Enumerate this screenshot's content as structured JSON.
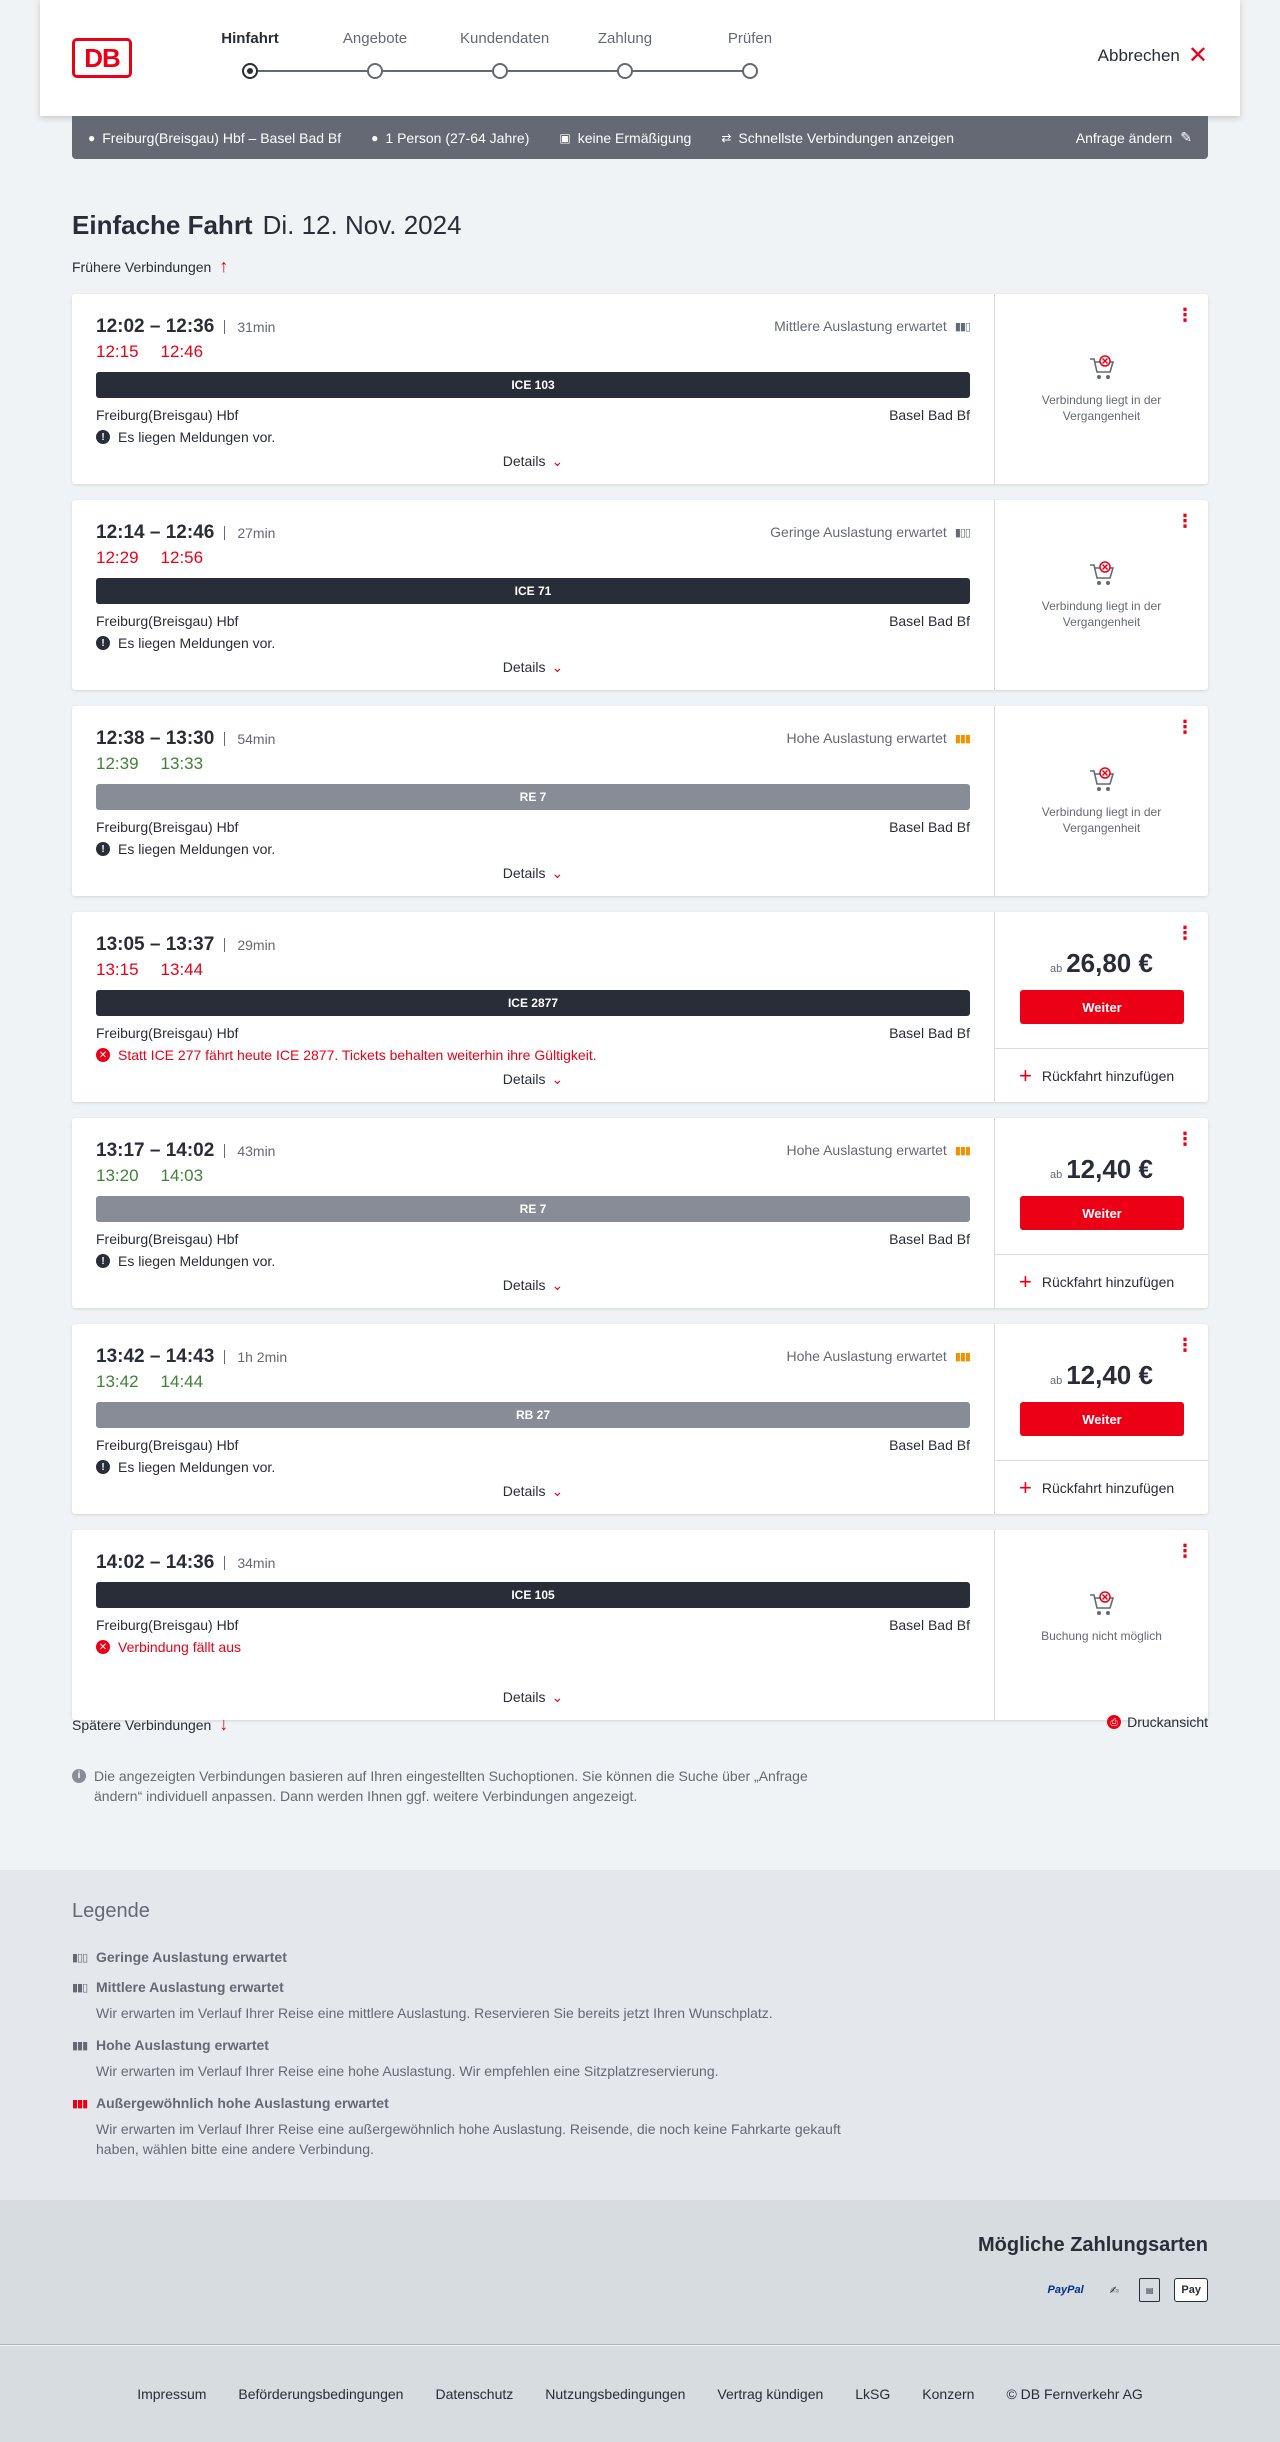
{
  "header": {
    "logo": "DB",
    "steps": [
      {
        "label": "Hinfahrt",
        "active": true
      },
      {
        "label": "Angebote",
        "active": false
      },
      {
        "label": "Kundendaten",
        "active": false
      },
      {
        "label": "Zahlung",
        "active": false
      },
      {
        "label": "Prüfen",
        "active": false
      }
    ],
    "cancel_label": "Abbrechen"
  },
  "search": {
    "route": "Freiburg(Breisgau) Hbf – Basel Bad Bf",
    "passengers": "1 Person (27-64 Jahre)",
    "discount": "keine Ermäßigung",
    "option": "Schnellste Verbindungen anzeigen",
    "change_label": "Anfrage ändern"
  },
  "page": {
    "title": "Einfache Fahrt",
    "date": "Di. 12. Nov. 2024",
    "earlier_label": "Frühere Verbindungen",
    "later_label": "Spätere Verbindungen",
    "print_label": "Druckansicht",
    "details_label": "Details",
    "info_text": "Die angezeigten Verbindungen basieren auf Ihren eingestellten Suchoptionen. Sie können die Suche über „Anfrage ändern“ individuell anpassen. Dann werden Ihnen ggf. weitere Verbindungen angezeigt."
  },
  "connections": [
    {
      "times": "12:02 – 12:36",
      "duration": "31min",
      "rt_dep": "12:15",
      "rt_arr": "12:46",
      "rt_color": "red",
      "load": "Mittlere Auslastung erwartet",
      "load_icon": "medium",
      "train": "ICE 103",
      "train_style": "dark",
      "from": "Freiburg(Breisgau) Hbf",
      "to": "Basel Bad Bf",
      "message": "Es liegen Meldungen vor.",
      "message_style": "info",
      "status": "past",
      "status_text": "Verbindung liegt in der Vergangenheit"
    },
    {
      "times": "12:14 – 12:46",
      "duration": "27min",
      "rt_dep": "12:29",
      "rt_arr": "12:56",
      "rt_color": "red",
      "load": "Geringe Auslastung erwartet",
      "load_icon": "low",
      "train": "ICE 71",
      "train_style": "dark",
      "from": "Freiburg(Breisgau) Hbf",
      "to": "Basel Bad Bf",
      "message": "Es liegen Meldungen vor.",
      "message_style": "info",
      "status": "past",
      "status_text": "Verbindung liegt in der Vergangenheit"
    },
    {
      "times": "12:38 – 13:30",
      "duration": "54min",
      "rt_dep": "12:39",
      "rt_arr": "13:33",
      "rt_color": "green",
      "load": "Hohe Auslastung erwartet",
      "load_icon": "high",
      "train": "RE 7",
      "train_style": "grey",
      "from": "Freiburg(Breisgau) Hbf",
      "to": "Basel Bad Bf",
      "message": "Es liegen Meldungen vor.",
      "message_style": "info",
      "status": "past",
      "status_text": "Verbindung liegt in der Vergangenheit"
    },
    {
      "times": "13:05 – 13:37",
      "duration": "29min",
      "rt_dep": "13:15",
      "rt_arr": "13:44",
      "rt_color": "red",
      "load": "",
      "load_icon": "",
      "train": "ICE 2877",
      "train_style": "dark",
      "from": "Freiburg(Breisgau) Hbf",
      "to": "Basel Bad Bf",
      "message": "Statt ICE 277 fährt heute ICE 2877. Tickets behalten weiterhin ihre Gültigkeit.",
      "message_style": "alert",
      "status": "bookable",
      "price_prefix": "ab",
      "price": "26,80 €",
      "button": "Weiter",
      "return_label": "Rückfahrt hinzufügen"
    },
    {
      "times": "13:17 – 14:02",
      "duration": "43min",
      "rt_dep": "13:20",
      "rt_arr": "14:03",
      "rt_color": "green",
      "load": "Hohe Auslastung erwartet",
      "load_icon": "high",
      "train": "RE 7",
      "train_style": "grey",
      "from": "Freiburg(Breisgau) Hbf",
      "to": "Basel Bad Bf",
      "message": "Es liegen Meldungen vor.",
      "message_style": "info",
      "status": "bookable",
      "price_prefix": "ab",
      "price": "12,40 €",
      "button": "Weiter",
      "return_label": "Rückfahrt hinzufügen"
    },
    {
      "times": "13:42 – 14:43",
      "duration": "1h 2min",
      "rt_dep": "13:42",
      "rt_arr": "14:44",
      "rt_color": "green",
      "load": "Hohe Auslastung erwartet",
      "load_icon": "high",
      "train": "RB 27",
      "train_style": "grey",
      "from": "Freiburg(Breisgau) Hbf",
      "to": "Basel Bad Bf",
      "message": "Es liegen Meldungen vor.",
      "message_style": "info",
      "status": "bookable",
      "price_prefix": "ab",
      "price": "12,40 €",
      "button": "Weiter",
      "return_label": "Rückfahrt hinzufügen"
    },
    {
      "times": "14:02 – 14:36",
      "duration": "34min",
      "rt_dep": "",
      "rt_arr": "",
      "rt_color": "",
      "load": "",
      "load_icon": "",
      "train": "ICE 105",
      "train_style": "dark",
      "from": "Freiburg(Breisgau) Hbf",
      "to": "Basel Bad Bf",
      "message": "Verbindung fällt aus",
      "message_style": "alert",
      "status": "unavailable",
      "status_text": "Buchung nicht möglich"
    }
  ],
  "legend": {
    "title": "Legende",
    "items": [
      {
        "title": "Geringe Auslastung erwartet",
        "desc": ""
      },
      {
        "title": "Mittlere Auslastung erwartet",
        "desc": "Wir erwarten im Verlauf Ihrer Reise eine mittlere Auslastung. Reservieren Sie bereits jetzt Ihren Wunschplatz."
      },
      {
        "title": "Hohe Auslastung erwartet",
        "desc": "Wir erwarten im Verlauf Ihrer Reise eine hohe Auslastung. Wir empfehlen eine Sitzplatzreservierung."
      },
      {
        "title": "Außergewöhnlich hohe Auslastung erwartet",
        "desc": "Wir erwarten im Verlauf Ihrer Reise eine außergewöhnlich hohe Auslastung. Reisende, die noch keine Fahrkarte gekauft haben, wählen bitte eine andere Verbindung."
      }
    ]
  },
  "payments": {
    "title": "Mögliche Zahlungsarten",
    "methods": [
      "PayPal",
      "Lastschrift",
      "Rechnung",
      "Apple Pay"
    ],
    "paypal_text": "PayPal",
    "applepay_text": "Pay"
  },
  "footer": {
    "links": [
      "Impressum",
      "Beförderungsbedingungen",
      "Datenschutz",
      "Nutzungsbedingungen",
      "Vertrag kündigen",
      "LkSG",
      "Konzern",
      "© DB Fernverkehr AG"
    ]
  },
  "colors": {
    "brand": "#ec0016",
    "dark": "#282d37",
    "grey": "#878c96",
    "green": "#408335",
    "orange": "#f39200"
  }
}
